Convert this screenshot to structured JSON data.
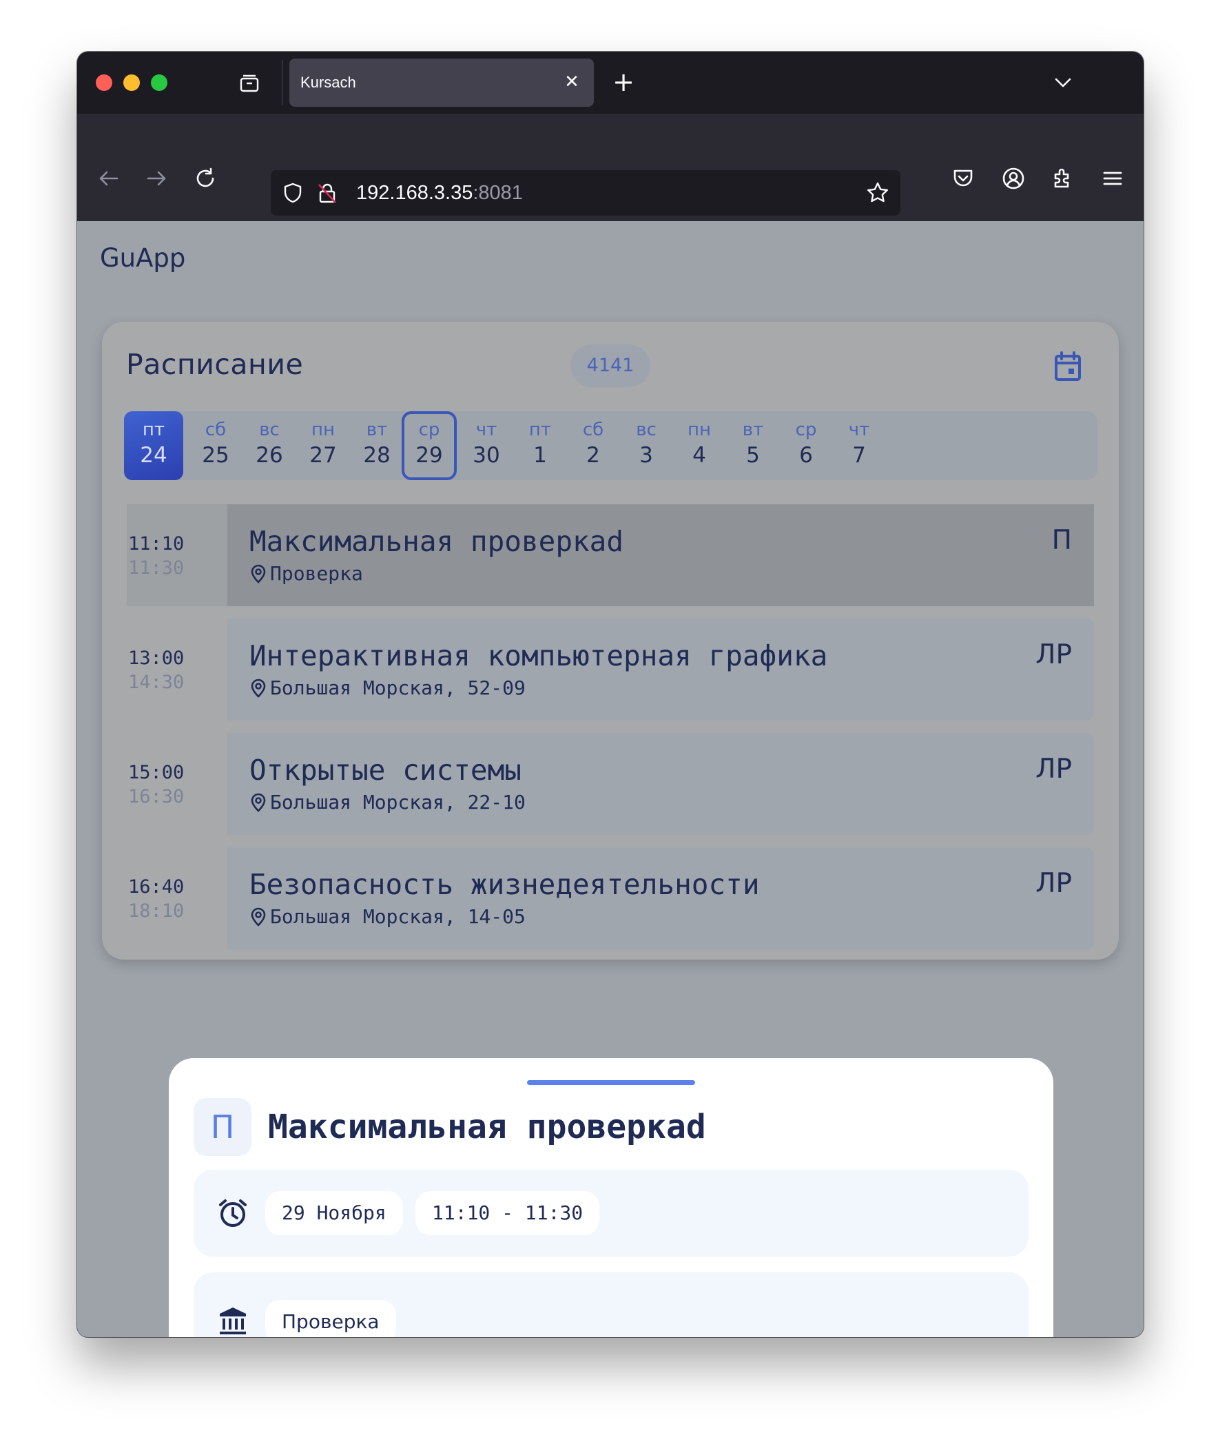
{
  "browser": {
    "tab_title": "Kursach",
    "url_host": "192.168.3.35",
    "url_port": ":8081"
  },
  "app": {
    "title": "GuApp"
  },
  "schedule": {
    "title": "Расписание",
    "group": "4141",
    "days": [
      {
        "dow": "пт",
        "num": "24",
        "state": "selected"
      },
      {
        "dow": "сб",
        "num": "25",
        "state": ""
      },
      {
        "dow": "вс",
        "num": "26",
        "state": ""
      },
      {
        "dow": "пн",
        "num": "27",
        "state": ""
      },
      {
        "dow": "вт",
        "num": "28",
        "state": ""
      },
      {
        "dow": "ср",
        "num": "29",
        "state": "today"
      },
      {
        "dow": "чт",
        "num": "30",
        "state": ""
      },
      {
        "dow": "пт",
        "num": "1",
        "state": ""
      },
      {
        "dow": "сб",
        "num": "2",
        "state": ""
      },
      {
        "dow": "вс",
        "num": "3",
        "state": ""
      },
      {
        "dow": "пн",
        "num": "4",
        "state": ""
      },
      {
        "dow": "вт",
        "num": "5",
        "state": ""
      },
      {
        "dow": "ср",
        "num": "6",
        "state": ""
      },
      {
        "dow": "чт",
        "num": "7",
        "state": ""
      }
    ],
    "lessons": [
      {
        "start": "11:10",
        "end": "11:30",
        "name": "Максимальная проверкаd",
        "location": "Проверка",
        "type": "П",
        "active": true
      },
      {
        "start": "13:00",
        "end": "14:30",
        "name": "Интерактивная компьютерная графика",
        "location": "Большая Морская, 52-09",
        "type": "ЛР",
        "active": false
      },
      {
        "start": "15:00",
        "end": "16:30",
        "name": "Открытые системы",
        "location": "Большая Морская, 22-10",
        "type": "ЛР",
        "active": false
      },
      {
        "start": "16:40",
        "end": "18:10",
        "name": "Безопасность жизнедеятельности",
        "location": "Большая Морская, 14-05",
        "type": "ЛР",
        "active": false
      }
    ]
  },
  "sheet": {
    "type": "П",
    "title": "Максимальная проверкаd",
    "date": "29 Ноября",
    "time": "11:10 - 11:30",
    "place": "Проверка"
  },
  "colors": {
    "accent": "#3a56b7",
    "selected_day": "#3f62d0",
    "handle": "#5b82ea"
  }
}
